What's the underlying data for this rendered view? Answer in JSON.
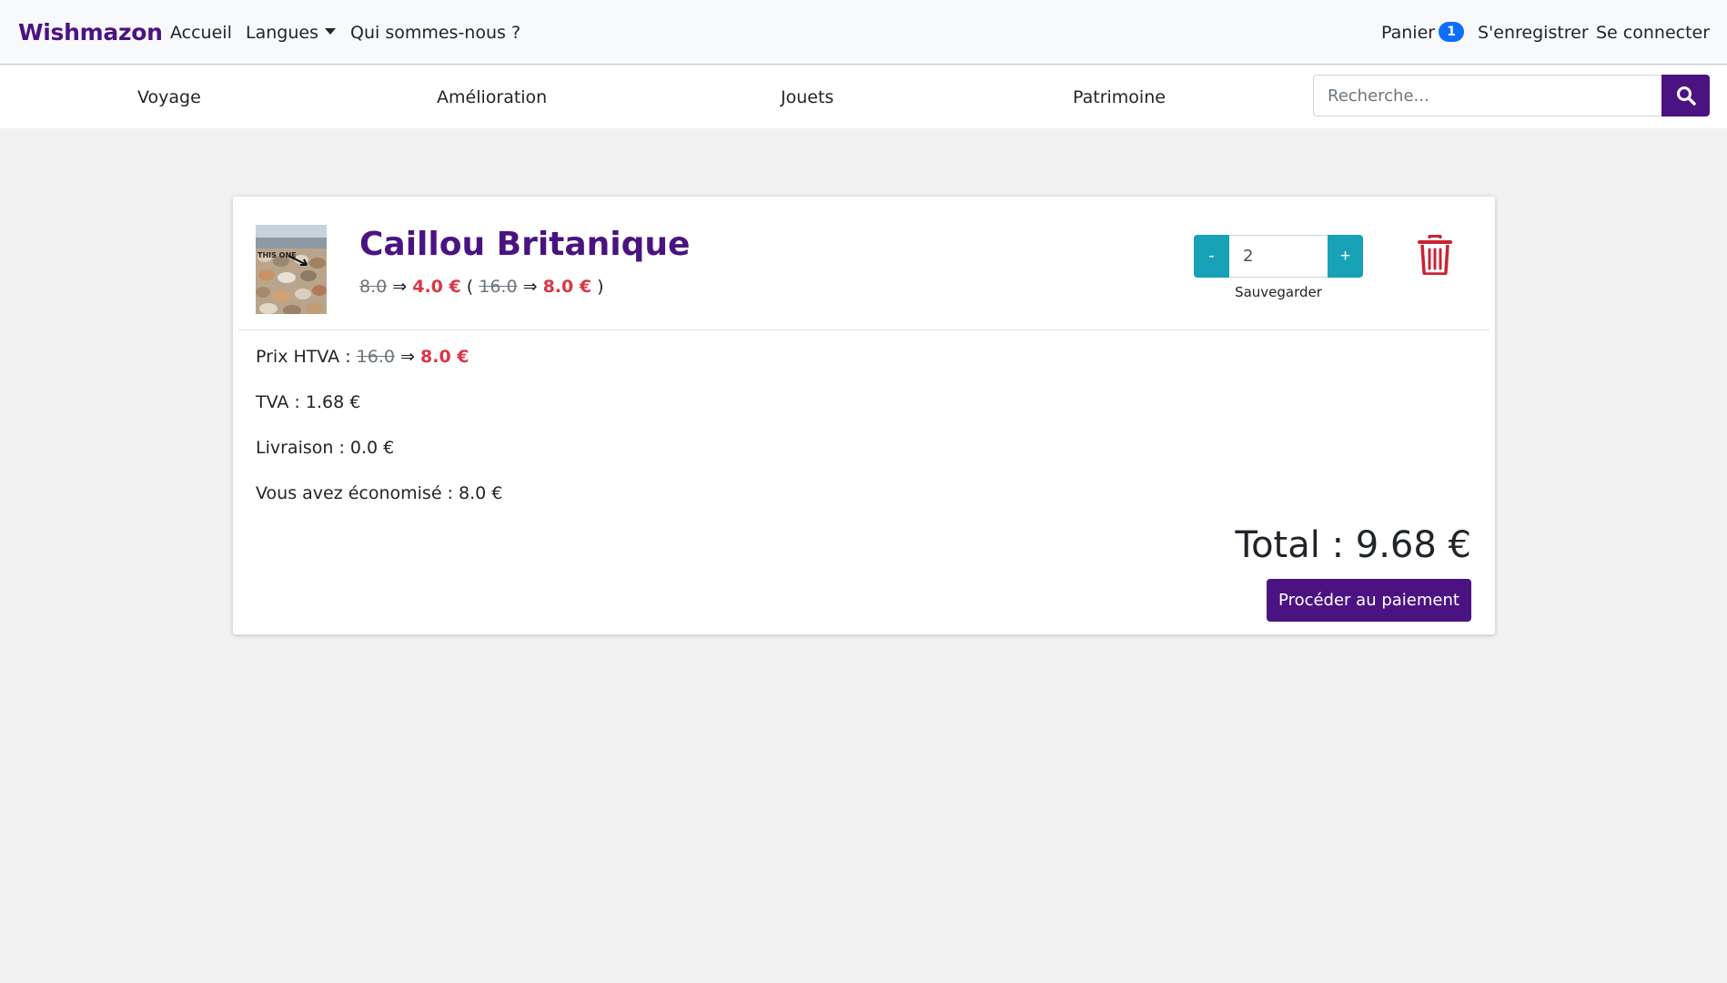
{
  "navbar": {
    "brand": "Wishmazon",
    "home": "Accueil",
    "languages": "Langues",
    "about": "Qui sommes-nous ?",
    "cart": "Panier",
    "cart_count": "1",
    "register": "S'enregistrer",
    "login": "Se connecter"
  },
  "categories": [
    "Voyage",
    "Amélioration",
    "Jouets",
    "Patrimoine"
  ],
  "search": {
    "placeholder": "Recherche..."
  },
  "cart_item": {
    "title": "Caillou Britanique",
    "unit_old": "8.0",
    "arrow": "⇒",
    "unit_new": "4.0 €",
    "open_paren": "(",
    "line_old": "16.0",
    "line_new": "8.0 €",
    "close_paren": ")",
    "image_overlay_text": "THIS ONE",
    "quantity": "2",
    "minus": "-",
    "plus": "+",
    "save_label": "Sauvegarder"
  },
  "summary": {
    "htva_label": "Prix HTVA :",
    "htva_old": "16.0",
    "htva_new": "8.0 €",
    "tva": "TVA : 1.68 €",
    "delivery": "Livraison : 0.0 €",
    "saved": "Vous avez économisé : 8.0 €",
    "total": "Total : 9.68 €",
    "checkout": "Procéder au paiement"
  },
  "colors": {
    "brand": "#4b1382",
    "price_red": "#dc3545",
    "teal": "#17a2b8",
    "badge_blue": "#0d6efd"
  }
}
